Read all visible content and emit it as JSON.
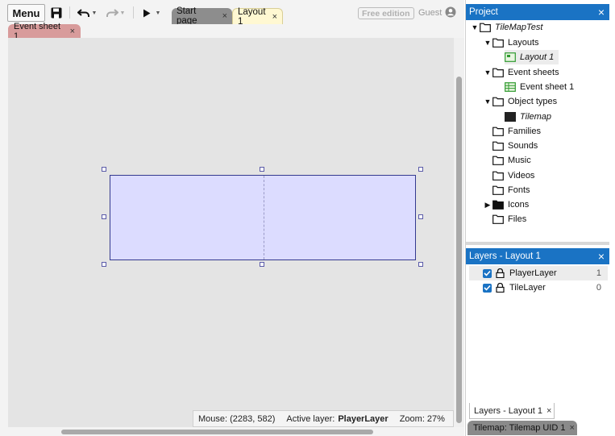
{
  "toolbar": {
    "menu_label": "Menu",
    "tabs": [
      {
        "label": "Start page",
        "close": "×"
      },
      {
        "label": "Layout 1",
        "close": "×"
      }
    ],
    "free_edition": "Free edition",
    "guest": "Guest"
  },
  "subtabs": [
    {
      "label": "Event sheet 1",
      "close": "×"
    }
  ],
  "status": {
    "mouse": "Mouse: (2283, 582)",
    "active_layer_label": "Active layer:",
    "active_layer_value": "PlayerLayer",
    "zoom": "Zoom: 27%"
  },
  "project": {
    "title": "Project",
    "close": "×",
    "root": "TileMapTest",
    "items": [
      "Layouts",
      "Layout 1",
      "Event sheets",
      "Event sheet 1",
      "Object types",
      "Tilemap",
      "Families",
      "Sounds",
      "Music",
      "Videos",
      "Fonts",
      "Icons",
      "Files"
    ]
  },
  "layers": {
    "title": "Layers - Layout 1",
    "close": "×",
    "items": [
      {
        "name": "PlayerLayer",
        "index": "1"
      },
      {
        "name": "TileLayer",
        "index": "0"
      }
    ]
  },
  "bottom_tabs": [
    {
      "label": "Layers - Layout 1",
      "close": "×"
    },
    {
      "label": "Tilemap: Tilemap UID 1",
      "close": "×"
    }
  ],
  "colors": {
    "accent": "#1a73c4",
    "tile_fill": "#dcdcff",
    "tile_border": "#343a8f",
    "layout_tab": "#fff8d2",
    "event_tab": "#d89b9b"
  }
}
